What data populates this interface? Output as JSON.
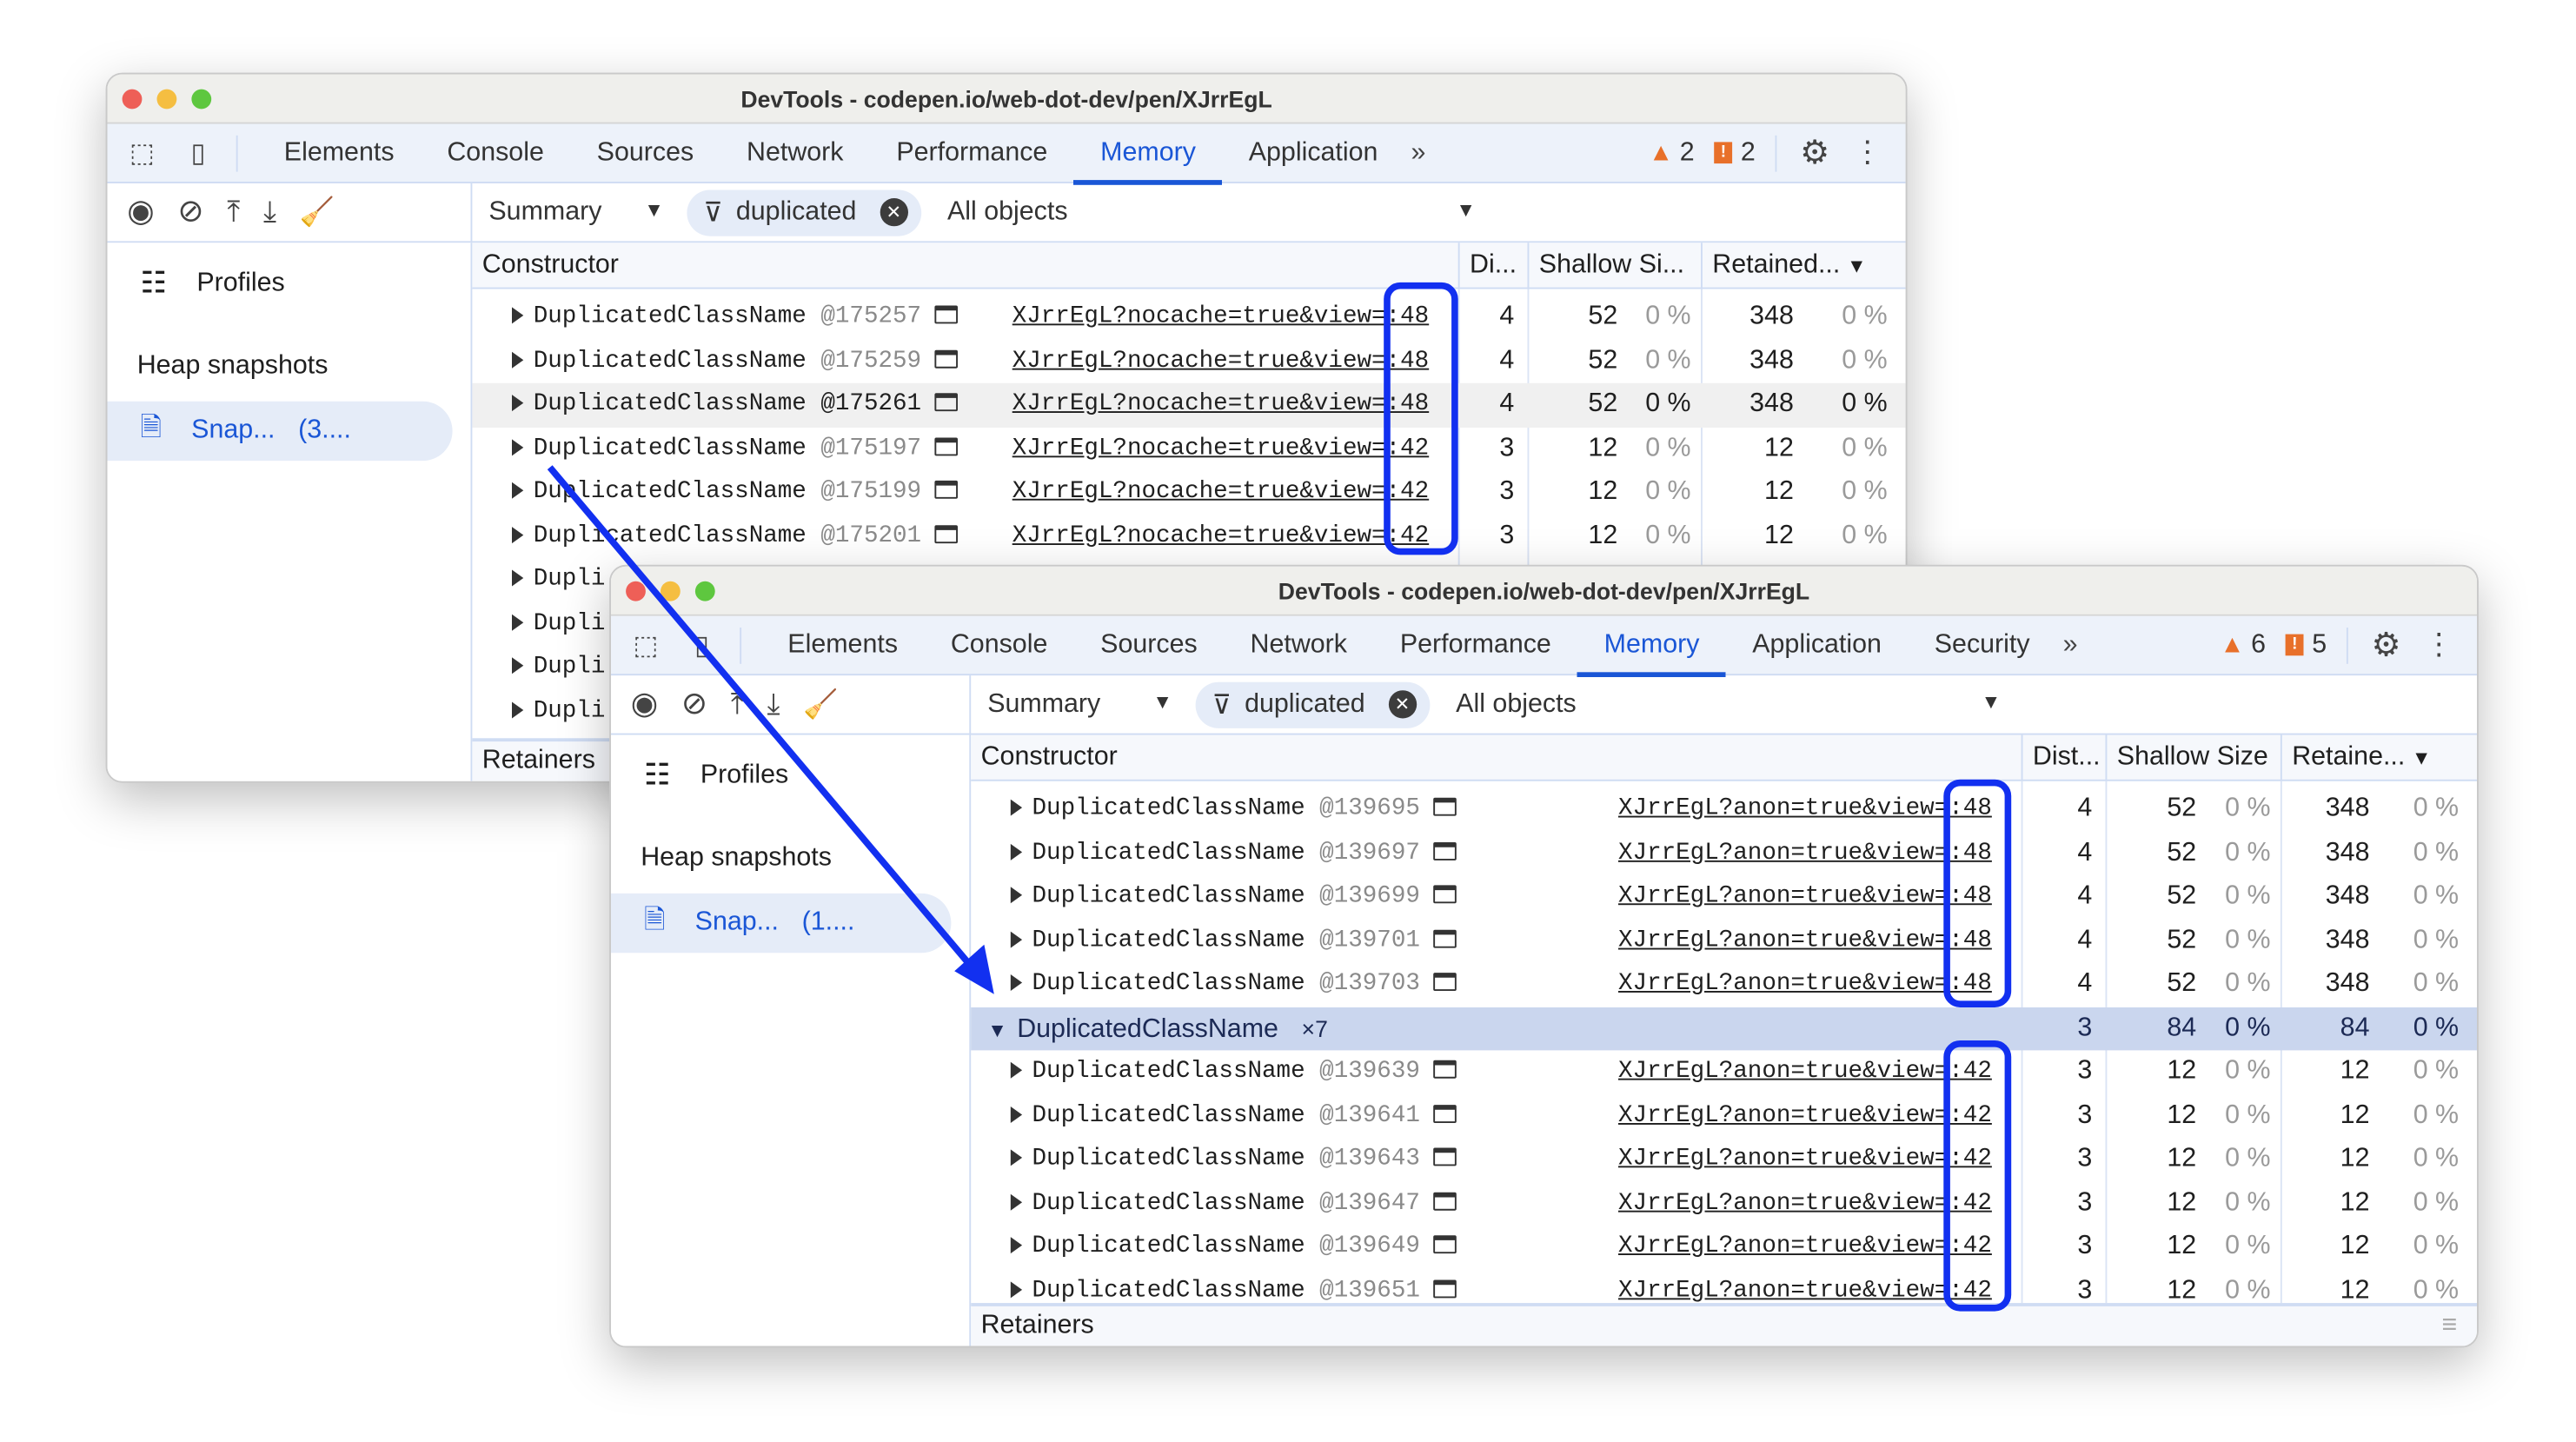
{
  "colors": {
    "accent": "#1a56d6",
    "highlight": "#1230f0",
    "warning": "#e8702a",
    "selected_row": "#cad6ee"
  },
  "back_window": {
    "title": "DevTools - codepen.io/web-dot-dev/pen/XJrrEgL",
    "tabs": [
      "Elements",
      "Console",
      "Sources",
      "Network",
      "Performance",
      "Memory",
      "Application"
    ],
    "active_tab": "Memory",
    "warnings": "2",
    "issues": "2",
    "toolbar": {
      "view": "Summary",
      "filter": "duplicated",
      "objects": "All objects"
    },
    "sidebar": {
      "profiles": "Profiles",
      "heading": "Heap snapshots",
      "snapshot": "Snap...",
      "snapshot_size": "(3...."
    },
    "columns": [
      "Constructor",
      "Di...",
      "Shallow Si...",
      "Retained..."
    ],
    "rows": [
      {
        "name": "DuplicatedClassName",
        "id": "@175257",
        "link": "XJrrEgL?nocache=true&view=",
        "line": ":48",
        "dist": "4",
        "shallow": "52",
        "shallow_pct": "0 %",
        "retained": "348",
        "retained_pct": "0 %"
      },
      {
        "name": "DuplicatedClassName",
        "id": "@175259",
        "link": "XJrrEgL?nocache=true&view=",
        "line": ":48",
        "dist": "4",
        "shallow": "52",
        "shallow_pct": "0 %",
        "retained": "348",
        "retained_pct": "0 %"
      },
      {
        "name": "DuplicatedClassName",
        "id": "@175261",
        "link": "XJrrEgL?nocache=true&view=",
        "line": ":48",
        "dist": "4",
        "shallow": "52",
        "shallow_pct": "0 %",
        "retained": "348",
        "retained_pct": "0 %"
      },
      {
        "name": "DuplicatedClassName",
        "id": "@175197",
        "link": "XJrrEgL?nocache=true&view=",
        "line": ":42",
        "dist": "3",
        "shallow": "12",
        "shallow_pct": "0 %",
        "retained": "12",
        "retained_pct": "0 %"
      },
      {
        "name": "DuplicatedClassName",
        "id": "@175199",
        "link": "XJrrEgL?nocache=true&view=",
        "line": ":42",
        "dist": "3",
        "shallow": "12",
        "shallow_pct": "0 %",
        "retained": "12",
        "retained_pct": "0 %"
      },
      {
        "name": "DuplicatedClassName",
        "id": "@175201",
        "link": "XJrrEgL?nocache=true&view=",
        "line": ":42",
        "dist": "3",
        "shallow": "12",
        "shallow_pct": "0 %",
        "retained": "12",
        "retained_pct": "0 %"
      }
    ],
    "partial_rows": [
      "Dupli",
      "Dupli",
      "Dupli",
      "Dupli"
    ],
    "retainers": "Retainers"
  },
  "front_window": {
    "title": "DevTools - codepen.io/web-dot-dev/pen/XJrrEgL",
    "tabs": [
      "Elements",
      "Console",
      "Sources",
      "Network",
      "Performance",
      "Memory",
      "Application",
      "Security"
    ],
    "active_tab": "Memory",
    "warnings": "6",
    "issues": "5",
    "toolbar": {
      "view": "Summary",
      "filter": "duplicated",
      "objects": "All objects"
    },
    "sidebar": {
      "profiles": "Profiles",
      "heading": "Heap snapshots",
      "snapshot": "Snap...",
      "snapshot_size": "(1...."
    },
    "columns": [
      "Constructor",
      "Dist...",
      "Shallow Size",
      "Retaine..."
    ],
    "rows_top": [
      {
        "name": "DuplicatedClassName",
        "id": "@139695",
        "link": "XJrrEgL?anon=true&view=",
        "line": ":48",
        "dist": "4",
        "shallow": "52",
        "shallow_pct": "0 %",
        "retained": "348",
        "retained_pct": "0 %"
      },
      {
        "name": "DuplicatedClassName",
        "id": "@139697",
        "link": "XJrrEgL?anon=true&view=",
        "line": ":48",
        "dist": "4",
        "shallow": "52",
        "shallow_pct": "0 %",
        "retained": "348",
        "retained_pct": "0 %"
      },
      {
        "name": "DuplicatedClassName",
        "id": "@139699",
        "link": "XJrrEgL?anon=true&view=",
        "line": ":48",
        "dist": "4",
        "shallow": "52",
        "shallow_pct": "0 %",
        "retained": "348",
        "retained_pct": "0 %"
      },
      {
        "name": "DuplicatedClassName",
        "id": "@139701",
        "link": "XJrrEgL?anon=true&view=",
        "line": ":48",
        "dist": "4",
        "shallow": "52",
        "shallow_pct": "0 %",
        "retained": "348",
        "retained_pct": "0 %"
      },
      {
        "name": "DuplicatedClassName",
        "id": "@139703",
        "link": "XJrrEgL?anon=true&view=",
        "line": ":48",
        "dist": "4",
        "shallow": "52",
        "shallow_pct": "0 %",
        "retained": "348",
        "retained_pct": "0 %"
      }
    ],
    "group": {
      "name": "DuplicatedClassName",
      "count": "×7",
      "dist": "3",
      "shallow": "84",
      "shallow_pct": "0 %",
      "retained": "84",
      "retained_pct": "0 %"
    },
    "rows_bottom": [
      {
        "name": "DuplicatedClassName",
        "id": "@139639",
        "link": "XJrrEgL?anon=true&view=",
        "line": ":42",
        "dist": "3",
        "shallow": "12",
        "shallow_pct": "0 %",
        "retained": "12",
        "retained_pct": "0 %"
      },
      {
        "name": "DuplicatedClassName",
        "id": "@139641",
        "link": "XJrrEgL?anon=true&view=",
        "line": ":42",
        "dist": "3",
        "shallow": "12",
        "shallow_pct": "0 %",
        "retained": "12",
        "retained_pct": "0 %"
      },
      {
        "name": "DuplicatedClassName",
        "id": "@139643",
        "link": "XJrrEgL?anon=true&view=",
        "line": ":42",
        "dist": "3",
        "shallow": "12",
        "shallow_pct": "0 %",
        "retained": "12",
        "retained_pct": "0 %"
      },
      {
        "name": "DuplicatedClassName",
        "id": "@139647",
        "link": "XJrrEgL?anon=true&view=",
        "line": ":42",
        "dist": "3",
        "shallow": "12",
        "shallow_pct": "0 %",
        "retained": "12",
        "retained_pct": "0 %"
      },
      {
        "name": "DuplicatedClassName",
        "id": "@139649",
        "link": "XJrrEgL?anon=true&view=",
        "line": ":42",
        "dist": "3",
        "shallow": "12",
        "shallow_pct": "0 %",
        "retained": "12",
        "retained_pct": "0 %"
      },
      {
        "name": "DuplicatedClassName",
        "id": "@139651",
        "link": "XJrrEgL?anon=true&view=",
        "line": ":42",
        "dist": "3",
        "shallow": "12",
        "shallow_pct": "0 %",
        "retained": "12",
        "retained_pct": "0 %"
      }
    ],
    "retainers": "Retainers"
  }
}
